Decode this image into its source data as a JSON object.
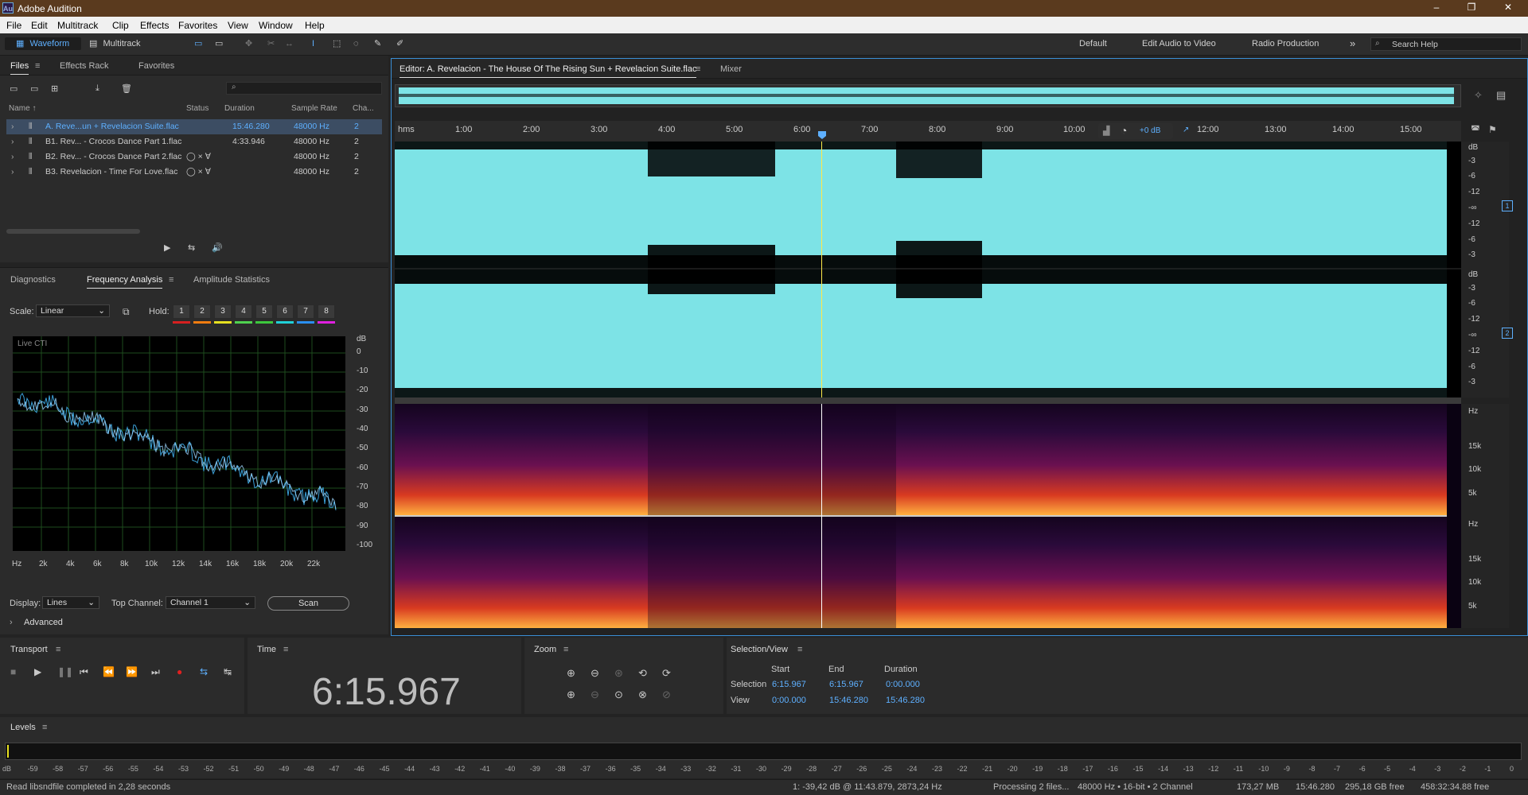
{
  "app": {
    "title": "Adobe Audition",
    "logo": "Au"
  },
  "window_controls": [
    "–",
    "❐",
    "✕"
  ],
  "menu": [
    "File",
    "Edit",
    "Multitrack",
    "Clip",
    "Effects",
    "Favorites",
    "View",
    "Window",
    "Help"
  ],
  "toolbar": {
    "waveform_label": "Waveform",
    "multitrack_label": "Multitrack",
    "workspaces": [
      "Default",
      "Edit Audio to Video",
      "Radio Production"
    ],
    "more": "»",
    "search_placeholder": "Search Help"
  },
  "files_panel": {
    "tabs": [
      "Files",
      "Effects Rack",
      "Favorites"
    ],
    "columns": [
      "Name ↑",
      "Status",
      "Duration",
      "Sample Rate",
      "Cha..."
    ],
    "rows": [
      {
        "name": "A. Reve...un + Revelacion Suite.flac",
        "status": "",
        "duration": "15:46.280",
        "rate": "48000 Hz",
        "channels": "2",
        "selected": true
      },
      {
        "name": "B1. Rev... - Crocos Dance Part 1.flac",
        "status": "",
        "duration": "4:33.946",
        "rate": "48000 Hz",
        "channels": "2",
        "selected": false
      },
      {
        "name": "B2. Rev... - Crocos Dance Part 2.flac",
        "status": "◯ × ∀",
        "duration": "",
        "rate": "48000 Hz",
        "channels": "2",
        "selected": false
      },
      {
        "name": "B3. Revelacion - Time For Love.flac",
        "status": "◯ × ∀",
        "duration": "",
        "rate": "48000 Hz",
        "channels": "2",
        "selected": false
      }
    ]
  },
  "analysis_panel": {
    "tabs": [
      "Diagnostics",
      "Frequency Analysis",
      "Amplitude Statistics"
    ],
    "scale_label": "Scale:",
    "scale_value": "Linear",
    "hold_label": "Hold:",
    "holds": [
      "1",
      "2",
      "3",
      "4",
      "5",
      "6",
      "7",
      "8"
    ],
    "hold_colors": [
      "#d62020",
      "#f07c10",
      "#e6e020",
      "#4fd24f",
      "#3dc83d",
      "#20d0d8",
      "#2a8ff0",
      "#e020e0"
    ],
    "live_label": "Live CTI",
    "db_unit": "dB",
    "db_ticks": [
      "0",
      "-10",
      "-20",
      "-30",
      "-40",
      "-50",
      "-60",
      "-70",
      "-80",
      "-90",
      "-100"
    ],
    "hz_ticks": [
      "Hz",
      "2k",
      "4k",
      "6k",
      "8k",
      "10k",
      "12k",
      "14k",
      "16k",
      "18k",
      "20k",
      "22k"
    ],
    "display_label": "Display:",
    "display_value": "Lines",
    "top_channel_label": "Top Channel:",
    "top_channel_value": "Channel 1",
    "scan_label": "Scan",
    "advanced_label": "Advanced"
  },
  "editor": {
    "tab_label": "Editor: A. Revelacion - The House Of The Rising Sun + Revelacion Suite.flac",
    "mixer_label": "Mixer",
    "ruler_unit": "hms",
    "ruler_ticks": [
      "1:00",
      "2:00",
      "3:00",
      "4:00",
      "5:00",
      "6:00",
      "7:00",
      "8:00",
      "9:00",
      "10:00",
      "12:00",
      "13:00",
      "14:00",
      "15:00"
    ],
    "gain_label": "+0 dB",
    "db_unit": "dB",
    "db_ticks_ch1": [
      "-3",
      "-6",
      "-12",
      "-∞",
      "-12",
      "-6",
      "-3"
    ],
    "db_ticks_ch2": [
      "-3",
      "-6",
      "-12",
      "-∞",
      "-12",
      "-6",
      "-3"
    ],
    "channel_badges": [
      "1",
      "2"
    ],
    "hz_unit": "Hz",
    "hz_ticks": [
      "15k",
      "10k",
      "5k"
    ]
  },
  "transport": {
    "title": "Transport",
    "buttons": [
      "■",
      "▶",
      "❚❚",
      "⏮",
      "⏪",
      "⏩",
      "⏭",
      "●",
      "⇆",
      "↹"
    ]
  },
  "time_panel": {
    "title": "Time",
    "value": "6:15.967"
  },
  "zoom_panel": {
    "title": "Zoom"
  },
  "selection_view": {
    "title": "Selection/View",
    "cols": [
      "Start",
      "End",
      "Duration"
    ],
    "selection_label": "Selection",
    "view_label": "View",
    "selection": [
      "6:15.967",
      "6:15.967",
      "0:00.000"
    ],
    "view": [
      "0:00.000",
      "15:46.280",
      "15:46.280"
    ]
  },
  "levels": {
    "title": "Levels",
    "ticks": [
      "dB",
      "-59",
      "-58",
      "-57",
      "-56",
      "-55",
      "-54",
      "-53",
      "-52",
      "-51",
      "-50",
      "-49",
      "-48",
      "-47",
      "-46",
      "-45",
      "-44",
      "-43",
      "-42",
      "-41",
      "-40",
      "-39",
      "-38",
      "-37",
      "-36",
      "-35",
      "-34",
      "-33",
      "-32",
      "-31",
      "-30",
      "-29",
      "-28",
      "-27",
      "-26",
      "-25",
      "-24",
      "-23",
      "-22",
      "-21",
      "-20",
      "-19",
      "-18",
      "-17",
      "-16",
      "-15",
      "-14",
      "-13",
      "-12",
      "-11",
      "-10",
      "-9",
      "-8",
      "-7",
      "-6",
      "-5",
      "-4",
      "-3",
      "-2",
      "-1",
      "0"
    ]
  },
  "status_bar": {
    "message": "Read libsndfile completed in 2,28 seconds",
    "cursor": "1: -39,42 dB @ 11:43.879, 2873,24 Hz",
    "processing": "Processing 2 files...",
    "format": "48000 Hz • 16-bit • 2 Channel",
    "size": "173,27 MB",
    "duration": "15:46.280",
    "free": "295,18 GB free",
    "free_time": "458:32:34.88 free"
  }
}
